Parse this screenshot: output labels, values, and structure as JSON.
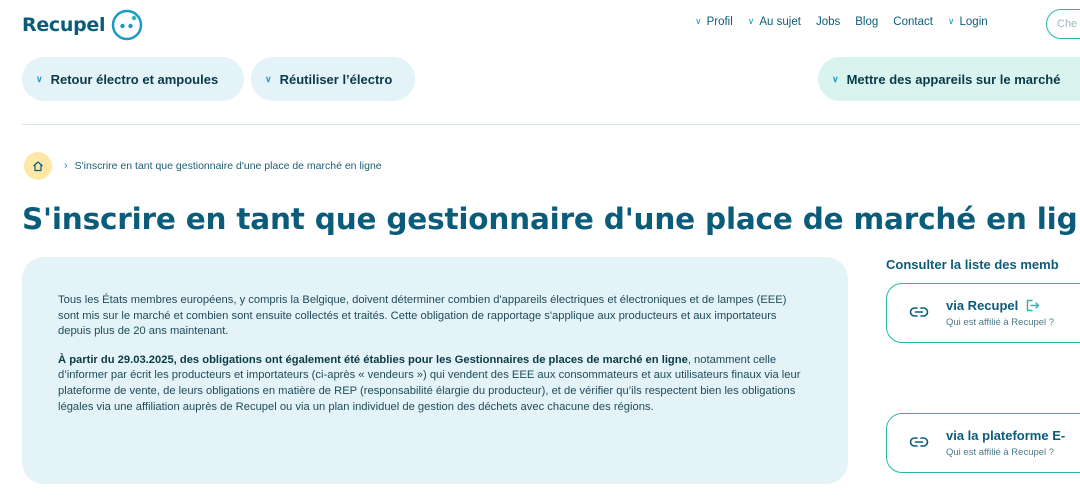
{
  "header": {
    "logo_text": "Recupel",
    "nav": [
      {
        "label": "Profil",
        "has_dropdown": true
      },
      {
        "label": "Au sujet",
        "has_dropdown": true
      },
      {
        "label": "Jobs",
        "has_dropdown": false
      },
      {
        "label": "Blog",
        "has_dropdown": false
      },
      {
        "label": "Contact",
        "has_dropdown": false
      },
      {
        "label": "Login",
        "has_dropdown": true
      }
    ],
    "search_placeholder": "Che"
  },
  "mainnav": {
    "items": [
      {
        "label": "Retour électro et ampoules"
      },
      {
        "label": "Réutiliser l’électro"
      },
      {
        "label": "Mettre des appareils sur le marché"
      }
    ]
  },
  "breadcrumb": {
    "current": "S'inscrire en tant que gestionnaire d'une place de marché en ligne"
  },
  "page": {
    "title": "S'inscrire en tant que gestionnaire d'une place de marché en ligne"
  },
  "infobox": {
    "para1": "Tous les États membres européens, y compris la Belgique, doivent déterminer combien d'appareils électriques et électroniques et de lampes (EEE) sont mis sur le marché et combien sont ensuite collectés et traités. Cette obligation de rapportage s'applique aux producteurs et aux importateurs depuis plus de 20 ans maintenant.",
    "para2_bold": "À partir du 29.03.2025, des obligations ont également été établies pour les Gestionnaires de places de marché en ligne",
    "para2_rest": ", notamment celle d’informer par écrit les producteurs et importateurs (ci-après « vendeurs ») qui vendent des EEE aux consommateurs et aux utilisateurs finaux via leur plateforme de vente, de leurs obligations en matière de REP (responsabilité élargie du producteur), et de vérifier qu’ils respectent bien les obligations légales via une affiliation auprès de Recupel ou via un plan individuel de gestion des déchets avec chacune des régions."
  },
  "sidebar": {
    "title": "Consulter la liste des memb",
    "cards": [
      {
        "title": "via Recupel",
        "subtitle": "Qui est affilié à Recupel ?",
        "icon": "external-link-icon"
      },
      {
        "title": "via la plateforme E-",
        "subtitle": "Qui est affilié à Recupel ?"
      }
    ]
  },
  "colors": {
    "brand_blue": "#0b5c7a",
    "accent_teal": "#2ab7a9",
    "light_blue": "#e3f3f8",
    "light_green": "#d9f4ee",
    "home_yellow": "#fde8a8"
  }
}
